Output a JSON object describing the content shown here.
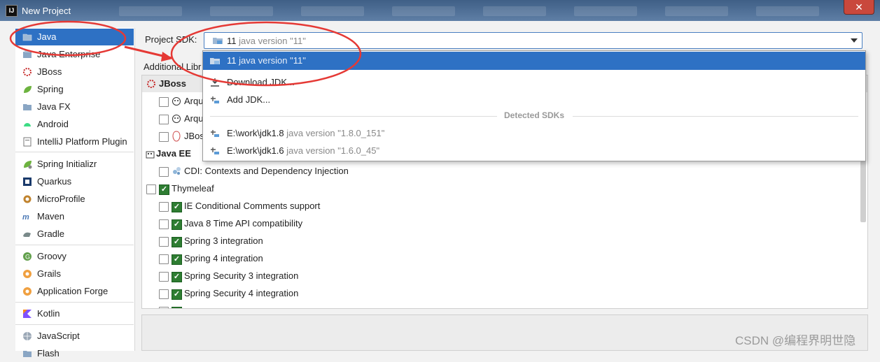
{
  "window": {
    "title": "New Project",
    "app_icon": "IJ",
    "close_glyph": "✕"
  },
  "sidebar": {
    "items": [
      {
        "label": "Java",
        "icon": "folder-icon",
        "selected": true
      },
      {
        "label": "Java Enterprise",
        "icon": "enterprise-icon"
      },
      {
        "label": "JBoss",
        "icon": "jboss-icon"
      },
      {
        "label": "Spring",
        "icon": "spring-leaf-icon"
      },
      {
        "label": "Java FX",
        "icon": "folder-icon"
      },
      {
        "label": "Android",
        "icon": "android-icon"
      },
      {
        "label": "IntelliJ Platform Plugin",
        "icon": "plugin-icon"
      },
      {
        "label": "Spring Initializr",
        "icon": "spring-initializr-icon"
      },
      {
        "label": "Quarkus",
        "icon": "quarkus-icon"
      },
      {
        "label": "MicroProfile",
        "icon": "microprofile-icon"
      },
      {
        "label": "Maven",
        "icon": "maven-icon"
      },
      {
        "label": "Gradle",
        "icon": "gradle-icon"
      },
      {
        "label": "Groovy",
        "icon": "groovy-icon"
      },
      {
        "label": "Grails",
        "icon": "grails-icon"
      },
      {
        "label": "Application Forge",
        "icon": "application-forge-icon"
      },
      {
        "label": "Kotlin",
        "icon": "kotlin-icon"
      },
      {
        "label": "JavaScript",
        "icon": "globe-icon"
      },
      {
        "label": "Flash",
        "icon": "folder-icon"
      }
    ]
  },
  "sdk": {
    "label": "Project SDK:",
    "value_main": "11",
    "value_detail": "java version \"11\""
  },
  "additional_libraries_label": "Additional Libr",
  "libraries": {
    "jboss_group": "JBoss",
    "jboss_items": [
      "Arqu",
      "Arqu",
      "JBos"
    ],
    "javaee_group": "Java EE",
    "cdi": "CDI: Contexts and Dependency Injection",
    "thymeleaf": "Thymeleaf",
    "thymeleaf_items": [
      "IE Conditional Comments support",
      "Java 8 Time API compatibility",
      "Spring 3 integration",
      "Spring 4 integration",
      "Spring Security 3 integration",
      "Spring Security 4 integration"
    ]
  },
  "sdk_popup": {
    "selected_main": "11",
    "selected_detail": "java version \"11\"",
    "download": "Download JDK...",
    "add": "Add JDK...",
    "detected_header": "Detected SDKs",
    "detected": [
      {
        "path": "E:\\work\\jdk1.8",
        "detail": "java version \"1.8.0_151\""
      },
      {
        "path": "E:\\work\\jdk1.6",
        "detail": "java version \"1.6.0_45\""
      }
    ]
  },
  "watermark": "CSDN @编程界明世隐",
  "colors": {
    "selection": "#2e71c4",
    "annotation": "#e53935",
    "check_green": "#2e7d32"
  }
}
